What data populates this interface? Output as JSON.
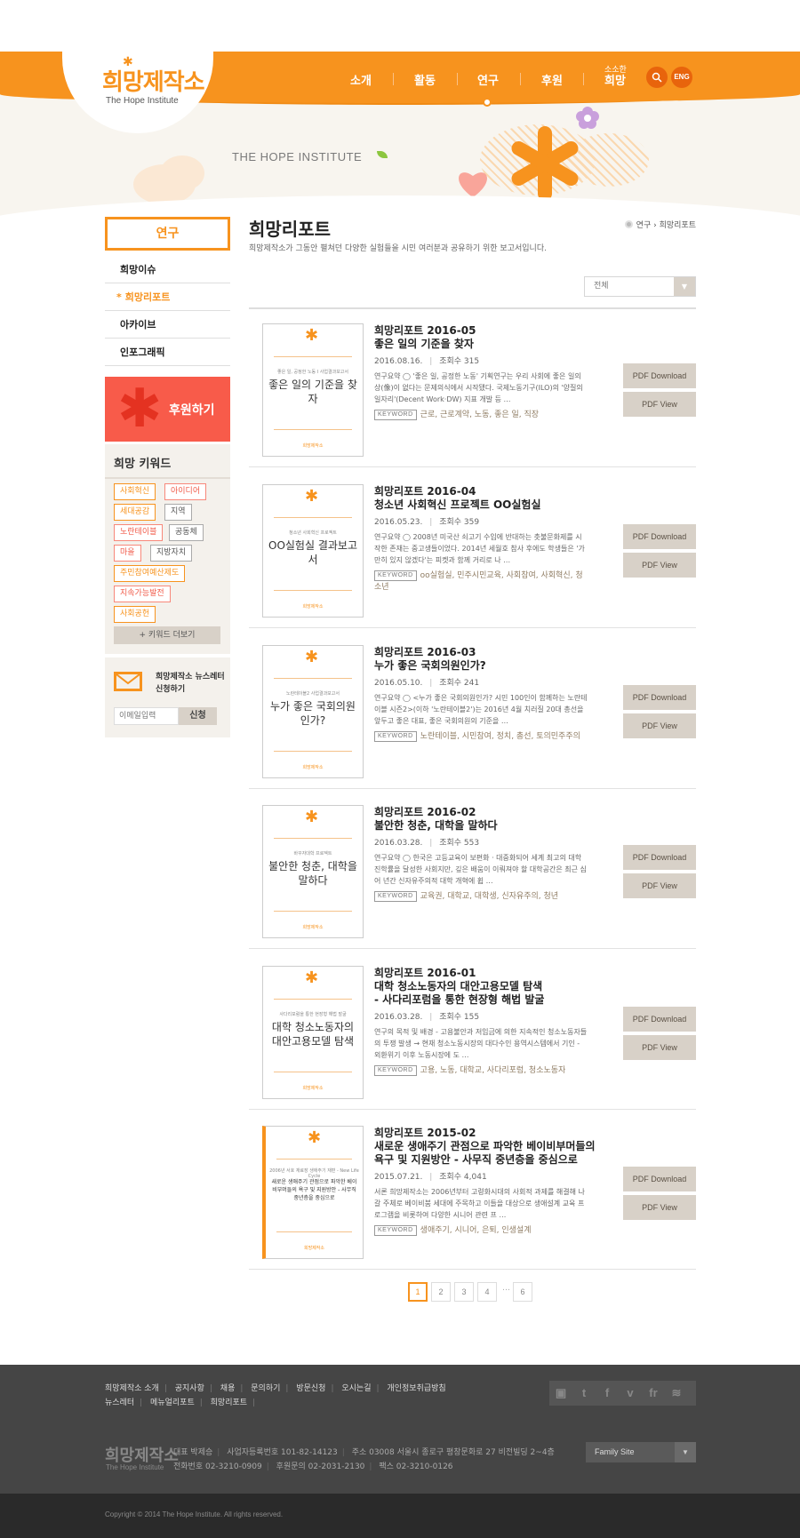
{
  "header": {
    "logo_ko": "희망제작소",
    "logo_en": "The Hope Institute",
    "nav": [
      "소개",
      "활동",
      "연구",
      "후원",
      "희망"
    ],
    "nav_sub": "소소한",
    "search_icon": "search-icon",
    "eng_label": "ENG",
    "visual_title": "THE HOPE INSTITUTE"
  },
  "lnb": {
    "title": "연구",
    "items": [
      {
        "label": "희망이슈",
        "star": ""
      },
      {
        "label": "희망리포트",
        "star": "*"
      },
      {
        "label": "아카이브",
        "star": ""
      },
      {
        "label": "인포그래픽",
        "star": ""
      }
    ],
    "donate_label": "후원하기",
    "keywords_title": "희망 키워드",
    "keywords": [
      "사회혁신",
      "아이디어",
      "세대공감",
      "지역",
      "노란테이블",
      "공동체",
      "마을",
      "지방자치",
      "주민참여예산제도",
      "지속가능발전",
      "사회공헌"
    ],
    "keywords_more": "+ 키워드 더보기",
    "newsletter_text": [
      "희망제작소 뉴스레터",
      "신청하기"
    ],
    "newsletter_placeholder": "이메일입력",
    "newsletter_button": "신청"
  },
  "content": {
    "title": "희망리포트",
    "description": "희망제작소가 그동안 펼쳐던 다양한 실험들을 시민 여러분과 공유하기 위한 보고서입니다.",
    "breadcrumb": [
      "연구",
      "희망리포트"
    ],
    "filter_value": "전체",
    "reports": [
      {
        "title_lines": [
          "희망리포트 2016-05",
          "좋은 일의 기준을 찾자"
        ],
        "date": "2016.08.16.",
        "views": "조회수 315",
        "summary": "연구요약 ◯ '좋은 일, 공정한 노동' 기획연구는 우리 사회에 좋은 일의 상(像)이 없다는 문제의식에서 시작됐다. 국제노동기구(ILO)의 '양질의 일자리'(Decent Work·DW) 지표 개발 등 …",
        "keywords": "근로, 근로계약, 노동, 좋은 일, 직장",
        "cover_title": "좋은 일의 기준을 찾자",
        "cover_sub": "좋은 일, 공정한 노동 I 사업결과보고서"
      },
      {
        "title_lines": [
          "희망리포트 2016-04",
          "청소년 사회혁신 프로젝트 OO실험실"
        ],
        "date": "2016.05.23.",
        "views": "조회수 359",
        "summary": "연구요약 ◯ 2008년 미국산 쇠고기 수입에 반대하는 촛불문화제를 시작한 존재는 중고생들이었다. 2014년 세월호 참사 후에도 학생들은 '가만히 있지 않겠다'는 피켓과 함께 거리로 나 …",
        "keywords": "oo실험실, 민주시민교육, 사회참여, 사회혁신, 청소년",
        "cover_title": "OO실험실 결과보고서",
        "cover_sub": "청소년 사회혁신 프로젝트"
      },
      {
        "title_lines": [
          "희망리포트 2016-03",
          "누가 좋은 국회의원인가?"
        ],
        "date": "2016.05.10.",
        "views": "조회수 241",
        "summary": "연구요약 ◯ <누가 좋은 국회의원인가? 시민 100인이 함께하는 노란테이블 시즌2>(이하 '노란테이블2')는 2016년 4월 치러질 20대 총선을 앞두고 좋은 대표, 좋은 국회의원의 기준을 …",
        "keywords": "노란테이블, 시민참여, 정치, 총선, 토의민주주의",
        "cover_title": "누가 좋은 국회의원인가?",
        "cover_sub": "노란테이블2 사업결과보고서"
      },
      {
        "title_lines": [
          "희망리포트 2016-02",
          "불안한 청춘, 대학을 말하다"
        ],
        "date": "2016.03.28.",
        "views": "조회수 553",
        "summary": "연구요약 ◯ 한국은 고등교육이 보편화 · 대중화되어 세계 최고의 대학진학률을 달성한 사회지만, 깊은 배움이 이뤄져야 할 대학공간은 최근 심어 년간 신자유주의적 대학 개혁에 휩 …",
        "keywords": "교육권, 대학교, 대학생, 신자유주의, 청년",
        "cover_title": "불안한 청춘, 대학을 말하다",
        "cover_sub": "바꾸자대학 프로젝트"
      },
      {
        "title_lines": [
          "희망리포트 2016-01",
          "대학 청소노동자의 대안고용모델 탐색",
          "- 사다리포럼을 통한 현장형 해법 발굴"
        ],
        "date": "2016.03.28.",
        "views": "조회수 155",
        "summary": "연구의 목적 및 배경 - 고용불안과 저임금에 의한 지속적인 청소노동자들의 투쟁 발생 → 현재 청소노동시장의 대다수인 용역시스템에서 기인 - 외환위기 이후 노동시장에 도 …",
        "keywords": "고용, 노동, 대학교, 사다리포럼, 청소노동자",
        "cover_title": "대학 청소노동자의 대안고용모델 탐색",
        "cover_sub": "사다리포럼을 통한 현장형 해법 발굴"
      },
      {
        "title_lines": [
          "희망리포트 2015-02",
          "새로운 생애주기 관점으로 파악한 베이비부머들의",
          "욕구 및 지원방안 - 사무직 중년층을 중심으로"
        ],
        "date": "2015.07.21.",
        "views": "조회수 4,041",
        "summary": "서론 희망제작소는 2006년부터 고령화시대의 사회적 과제를 해결해 나갈 주체로 베이비붐 세대에 주목하고 이들을 대상으로 생애설계 교육 프로그램을 비롯하여 다양한 시니어 관련 프 …",
        "keywords": "생애주기, 시니어, 은퇴, 인생설계",
        "cover_title": "새로운 생애주기 관점으로 파악한 베이비부머들의 욕구 및 지원방안 - 사무직 중년층을 중심으로",
        "cover_sub": "2006년 서호 재료장 생애주기 재편 - New Life Cycle"
      }
    ],
    "pdf_download": "PDF Download",
    "pdf_view": "PDF View",
    "keyword_badge": "KEYWORD",
    "pagination": [
      "1",
      "2",
      "3",
      "4",
      "…",
      "6"
    ]
  },
  "footer": {
    "links_row1": [
      "희망제작소 소개",
      "공지사항",
      "채용",
      "문의하기",
      "방문신청",
      "오시는길",
      "개인정보취급방침"
    ],
    "links_row2": [
      "뉴스레터",
      "메뉴얼리포트",
      "희망리포트"
    ],
    "sns": [
      "blog-icon",
      "twitter-icon",
      "facebook-icon",
      "vimeo-icon",
      "flickr-icon",
      "rss-icon"
    ],
    "logo_ko": "희망제작소",
    "logo_en": "The Hope Institute",
    "info_row1": [
      "대표 박제승",
      "사업자등록번호 101-82-14123",
      "주소 03008 서울시 종로구 평창문화로 27 비전빌딩 2~4층"
    ],
    "info_row2": [
      "전화번호 02-3210-0909",
      "후원문의 02-2031-2130",
      "팩스 02-3210-0126"
    ],
    "family_site": "Family Site",
    "copyright": "Copyright © 2014 The Hope Institute. All rights reserved."
  },
  "colors": {
    "accent": "#f7931e",
    "donate": "#f85b4a",
    "footer": "#454545"
  }
}
